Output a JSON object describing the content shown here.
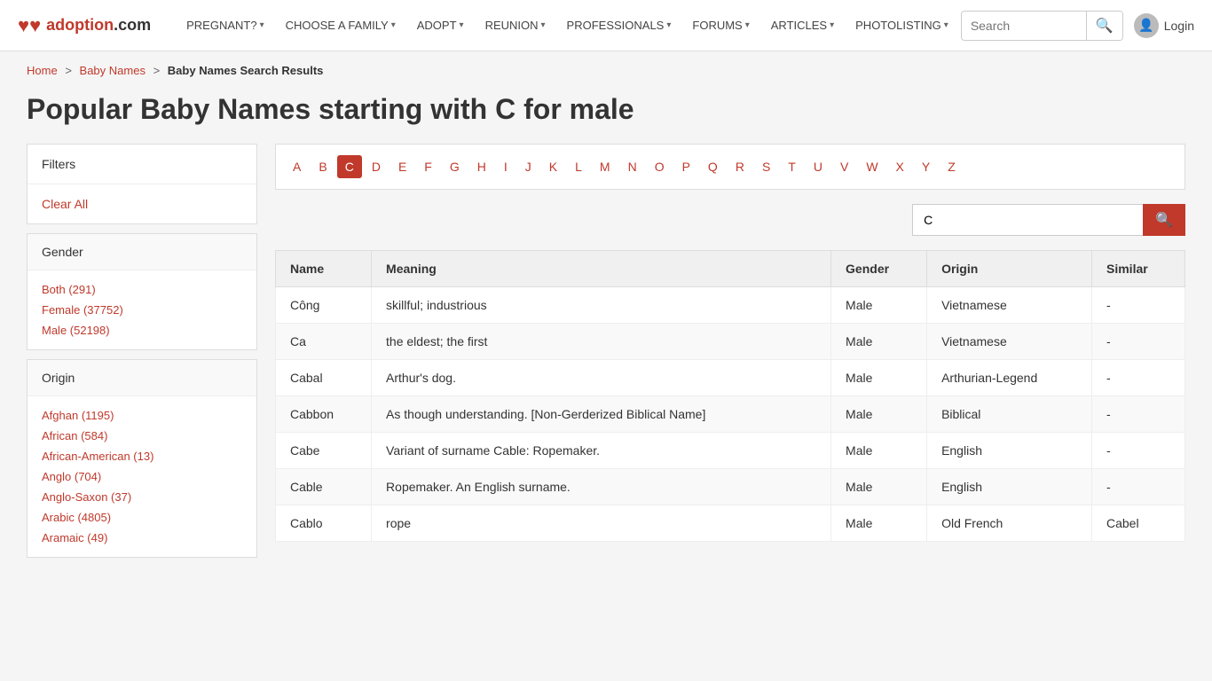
{
  "nav": {
    "logo_text": "adoption",
    "logo_suffix": ".com",
    "items": [
      {
        "label": "PREGNANT?",
        "has_dropdown": true
      },
      {
        "label": "CHOOSE A FAMILY",
        "has_dropdown": true
      },
      {
        "label": "ADOPT",
        "has_dropdown": true
      },
      {
        "label": "REUNION",
        "has_dropdown": true
      },
      {
        "label": "PROFESSIONALS",
        "has_dropdown": true
      },
      {
        "label": "FORUMS",
        "has_dropdown": true
      },
      {
        "label": "ARTICLES",
        "has_dropdown": true
      },
      {
        "label": "PHOTOLISTING",
        "has_dropdown": true
      }
    ],
    "search_placeholder": "Search",
    "login_label": "Login"
  },
  "breadcrumb": {
    "home": "Home",
    "baby_names": "Baby Names",
    "current": "Baby Names Search Results"
  },
  "page_title": "Popular Baby Names starting with C for male",
  "filters": {
    "header": "Filters",
    "clear_all": "Clear All",
    "gender_header": "Gender",
    "gender_items": [
      {
        "label": "Both (291)"
      },
      {
        "label": "Female (37752)"
      },
      {
        "label": "Male (52198)"
      }
    ],
    "origin_header": "Origin",
    "origin_items": [
      {
        "label": "Afghan (1195)"
      },
      {
        "label": "African (584)"
      },
      {
        "label": "African-American (13)"
      },
      {
        "label": "Anglo (704)"
      },
      {
        "label": "Anglo-Saxon (37)"
      },
      {
        "label": "Arabic (4805)"
      },
      {
        "label": "Aramaic (49)"
      }
    ]
  },
  "alphabet": {
    "letters": [
      "A",
      "B",
      "C",
      "D",
      "E",
      "F",
      "G",
      "H",
      "I",
      "J",
      "K",
      "L",
      "M",
      "N",
      "O",
      "P",
      "Q",
      "R",
      "S",
      "T",
      "U",
      "V",
      "W",
      "X",
      "Y",
      "Z"
    ],
    "active": "C"
  },
  "name_search": {
    "value": "C",
    "placeholder": ""
  },
  "table": {
    "headers": [
      "Name",
      "Meaning",
      "Gender",
      "Origin",
      "Similar"
    ],
    "rows": [
      {
        "name": "Công",
        "meaning": "skillful; industrious",
        "gender": "Male",
        "origin": "Vietnamese",
        "similar": "-"
      },
      {
        "name": "Ca",
        "meaning": "the eldest; the first",
        "gender": "Male",
        "origin": "Vietnamese",
        "similar": "-"
      },
      {
        "name": "Cabal",
        "meaning": "Arthur's dog.",
        "gender": "Male",
        "origin": "Arthurian-Legend",
        "similar": "-"
      },
      {
        "name": "Cabbon",
        "meaning": "As though understanding. [Non-Gerderized Biblical Name]",
        "gender": "Male",
        "origin": "Biblical",
        "similar": "-"
      },
      {
        "name": "Cabe",
        "meaning": "Variant of surname Cable: Ropemaker.",
        "gender": "Male",
        "origin": "English",
        "similar": "-"
      },
      {
        "name": "Cable",
        "meaning": "Ropemaker. An English surname.",
        "gender": "Male",
        "origin": "English",
        "similar": "-"
      },
      {
        "name": "Cablo",
        "meaning": "rope",
        "gender": "Male",
        "origin": "Old French",
        "similar": "Cabel"
      }
    ]
  }
}
